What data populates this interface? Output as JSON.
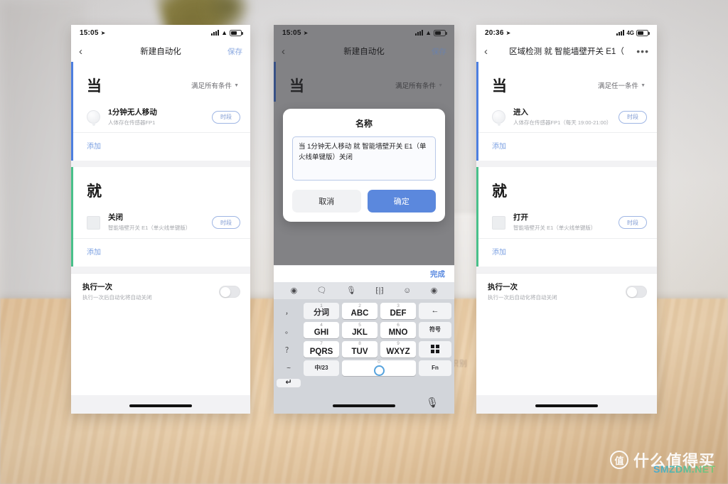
{
  "watermark": {
    "badge": "值",
    "text": "什么值得买",
    "sub": "SMZDM.NET"
  },
  "background": {
    "faint_text": "识别"
  },
  "phone1": {
    "status": {
      "time": "15:05",
      "location_icon": "location-arrow-icon",
      "network": "",
      "battery": "battery-icon"
    },
    "nav": {
      "back": "‹",
      "title": "新建自动化",
      "action": "保存"
    },
    "when": {
      "char": "当",
      "condition_mode": "满足所有条件",
      "rows": [
        {
          "title": "1分钟无人移动",
          "sub": "人体存在传感器FP1",
          "pill": "时段",
          "icon": "round-sensor-icon"
        }
      ],
      "add": "添加"
    },
    "then": {
      "char": "就",
      "rows": [
        {
          "title": "关闭",
          "sub": "智能墙壁开关 E1（单火线单键版）",
          "pill": "时段",
          "icon": "square-switch-icon"
        }
      ],
      "add": "添加"
    },
    "once": {
      "title": "执行一次",
      "sub": "执行一次后自动化将自动关闭",
      "toggle": "off"
    }
  },
  "phone2": {
    "status": {
      "time": "15:05",
      "battery": "battery-icon"
    },
    "nav": {
      "back": "‹",
      "title": "新建自动化",
      "action": "保存"
    },
    "when": {
      "char": "当",
      "condition_mode": "满足所有条件"
    },
    "dialog": {
      "title": "名称",
      "input_value": "当 1分钟无人移动 就 智能墙壁开关 E1（单火线单键版）关闭",
      "cancel": "取消",
      "confirm": "确定"
    },
    "keyboard": {
      "done": "完成",
      "toolbar_icons": [
        "keyboard-settings-icon",
        "chat-icon",
        "microphone-icon",
        "cursor-move-icon",
        "emoji-icon",
        "record-icon"
      ],
      "symbols": [
        "，",
        "。",
        "？",
        "！",
        "~"
      ],
      "keys": [
        {
          "num": "1",
          "label": "分词",
          "type": "fn"
        },
        {
          "num": "2",
          "label": "ABC",
          "type": "letter"
        },
        {
          "num": "3",
          "label": "DEF",
          "type": "letter"
        },
        {
          "num": "",
          "label": "←",
          "type": "backspace"
        },
        {
          "num": "4",
          "label": "GHI",
          "type": "letter"
        },
        {
          "num": "5",
          "label": "JKL",
          "type": "letter"
        },
        {
          "num": "6",
          "label": "MNO",
          "type": "letter"
        },
        {
          "num": "",
          "label": "符号",
          "type": "symbols"
        },
        {
          "num": "7",
          "label": "PQRS",
          "type": "letter"
        },
        {
          "num": "8",
          "label": "TUV",
          "type": "letter"
        },
        {
          "num": "9",
          "label": "WXYZ",
          "type": "letter"
        },
        {
          "num": "",
          "label": "grid-icon",
          "type": "grid"
        },
        {
          "num": "",
          "label": "中/23",
          "type": "mode"
        },
        {
          "num": "0",
          "label": "space-ring-icon",
          "type": "space"
        },
        {
          "num": "",
          "label": "Fn",
          "type": "fn2"
        },
        {
          "num": "",
          "label": "↵",
          "type": "enter"
        }
      ],
      "mic": "microphone-icon"
    }
  },
  "phone3": {
    "status": {
      "time": "20:36",
      "network": "4G",
      "battery": "battery-icon"
    },
    "nav": {
      "back": "‹",
      "title": "区域检测 就 智能墙壁开关 E1（",
      "more": "•••"
    },
    "when": {
      "char": "当",
      "condition_mode": "满足任一条件",
      "rows": [
        {
          "title": "进入",
          "sub": "人体存在传感器FP1（每天 19:00-21:00）",
          "pill": "时段",
          "icon": "round-sensor-icon"
        }
      ],
      "add": "添加"
    },
    "then": {
      "char": "就",
      "rows": [
        {
          "title": "打开",
          "sub": "智能墙壁开关 E1（单火线单键版）",
          "pill": "时段",
          "icon": "square-switch-icon"
        }
      ],
      "add": "添加"
    },
    "once": {
      "title": "执行一次",
      "sub": "执行一次后自动化将自动关闭",
      "toggle": "off"
    }
  }
}
